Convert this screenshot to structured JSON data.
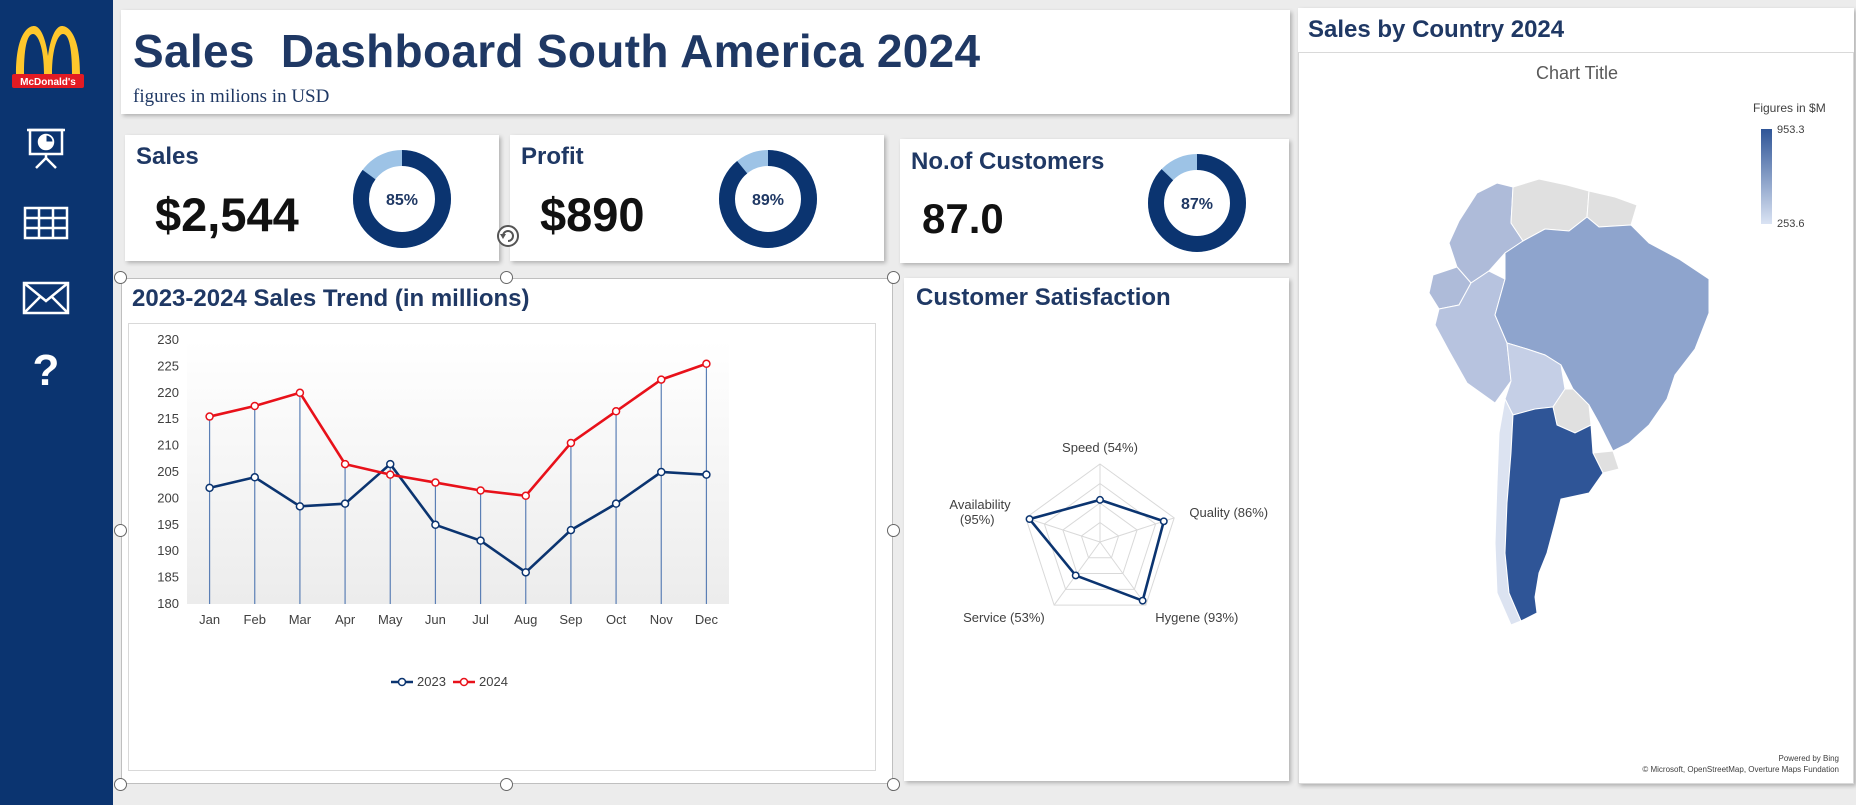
{
  "sidebar": {
    "logo_text": "McDonald's",
    "icons": [
      "presentation-chart-icon",
      "table-grid-icon",
      "mail-icon",
      "help-icon"
    ],
    "help_glyph": "?"
  },
  "header": {
    "title": "Sales  Dashboard South America 2024",
    "subtitle": "figures in milions in USD"
  },
  "kpis": [
    {
      "label": "Sales",
      "value": "$2,544",
      "percent": 85,
      "percent_label": "85%"
    },
    {
      "label": "Profit",
      "value": "$890",
      "percent": 89,
      "percent_label": "89%"
    },
    {
      "label": "No.of  Customers",
      "value": "87.0",
      "percent": 87,
      "percent_label": "87%"
    }
  ],
  "colors": {
    "navy": "#0b3470",
    "title": "#1f3864",
    "donut_main": "#0b3470",
    "donut_rest": "#9dc3e6",
    "line_2023": "#0b3470",
    "line_2024": "#e8111a"
  },
  "trend": {
    "title": "2023-2024 Sales Trend (in millions)",
    "chart_data": {
      "type": "line",
      "categories": [
        "Jan",
        "Feb",
        "Mar",
        "Apr",
        "May",
        "Jun",
        "Jul",
        "Aug",
        "Sep",
        "Oct",
        "Nov",
        "Dec"
      ],
      "series": [
        {
          "name": "2023",
          "values": [
            202,
            204,
            198.5,
            199,
            206.5,
            195,
            192,
            186,
            194,
            199,
            205,
            204.5
          ]
        },
        {
          "name": "2024",
          "values": [
            215.5,
            217.5,
            220,
            206.5,
            204.5,
            203,
            201.5,
            200.5,
            210.5,
            216.5,
            222.5,
            225.5
          ]
        }
      ],
      "ylim": [
        180,
        230
      ],
      "yticks": [
        "180",
        "185",
        "190",
        "195",
        "200",
        "205",
        "210",
        "215",
        "220",
        "225",
        "230"
      ],
      "legend": "bottom",
      "grid": false
    }
  },
  "satisfaction": {
    "title": "Customer Satisfaction",
    "chart_data": {
      "type": "radar",
      "axes": [
        "Speed (54%)",
        "Quality (86%)",
        "Hygene (93%)",
        "Service (53%)",
        "Availability (95%)"
      ],
      "values": [
        54,
        86,
        93,
        53,
        95
      ],
      "max": 100
    }
  },
  "map": {
    "title": "Sales by Country 2024",
    "chart_title": "Chart Title",
    "legend_title": "Figures in $M",
    "legend_max": "953.3",
    "legend_min": "253.6",
    "attribution_1": "Powered by Bing",
    "attribution_2": "© Microsoft, OpenStreetMap, Overture Maps Fundation"
  }
}
